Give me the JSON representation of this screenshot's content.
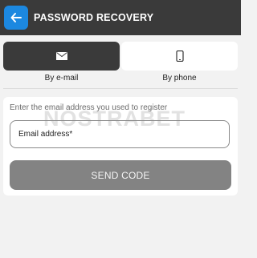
{
  "header": {
    "title": "PASSWORD RECOVERY",
    "back_icon": "arrow-left-icon"
  },
  "tabs": [
    {
      "label": "By e-mail",
      "icon": "envelope-icon",
      "active": true
    },
    {
      "label": "By phone",
      "icon": "phone-icon",
      "active": false
    }
  ],
  "form": {
    "hint": "Enter the email address you used to register",
    "email_placeholder": "Email address*",
    "submit_label": "SEND CODE",
    "watermark": "NOSTRABET"
  },
  "colors": {
    "header_bg": "#3a3a3a",
    "accent": "#1c88e0",
    "button_disabled": "#838383",
    "page_bg": "#f2f2f2"
  }
}
